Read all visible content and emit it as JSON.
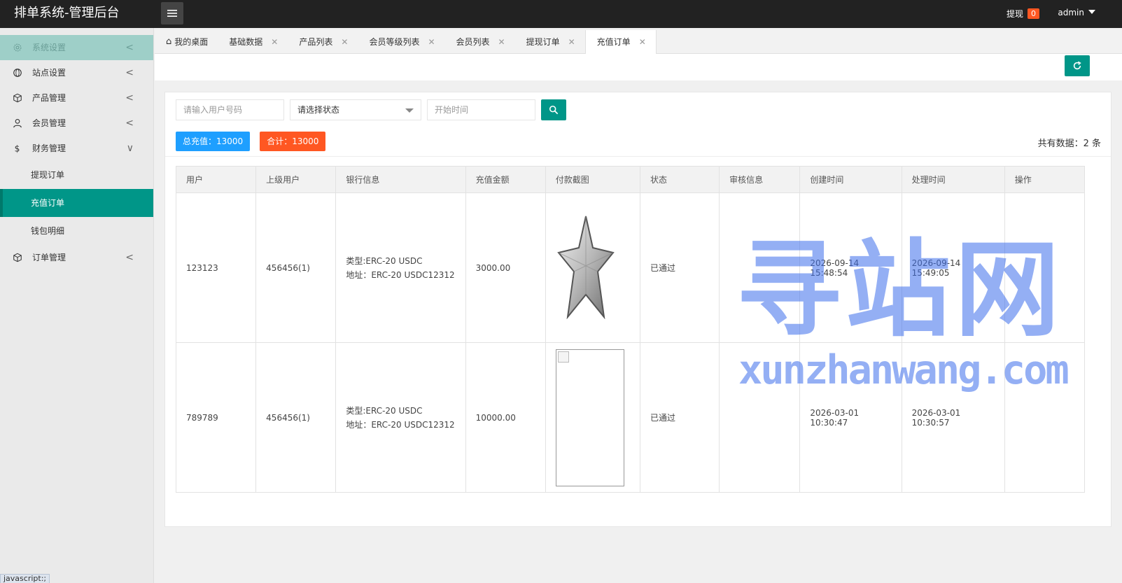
{
  "header": {
    "title": "排单系统-管理后台",
    "withdraw_label": "提现",
    "withdraw_count": "0",
    "user": "admin"
  },
  "sidebar": {
    "items": [
      {
        "label": "系统设置",
        "icon": "gear-icon"
      },
      {
        "label": "站点设置",
        "icon": "globe-icon"
      },
      {
        "label": "产品管理",
        "icon": "cube-icon"
      },
      {
        "label": "会员管理",
        "icon": "user-icon"
      },
      {
        "label": "财务管理",
        "icon": "dollar-icon"
      }
    ],
    "sub_items": [
      "提现订单",
      "充值订单",
      "钱包明细"
    ],
    "order_mgmt": {
      "label": "订单管理",
      "icon": "cube-icon"
    }
  },
  "tabs": [
    {
      "label": "我的桌面"
    },
    {
      "label": "基础数据"
    },
    {
      "label": "产品列表"
    },
    {
      "label": "会员等级列表"
    },
    {
      "label": "会员列表"
    },
    {
      "label": "提现订单"
    },
    {
      "label": "充值订单"
    }
  ],
  "search": {
    "user_placeholder": "请输入用户号码",
    "status_select": "请选择状态",
    "start_time_placeholder": "开始时间"
  },
  "summary": {
    "total_recharge": "总充值：13000",
    "sum": "合计：13000",
    "total_count": "共有数据：2 条"
  },
  "table": {
    "headers": [
      "用户",
      "上级用户",
      "银行信息",
      "充值金额",
      "付款截图",
      "状态",
      "审核信息",
      "创建时间",
      "处理时间",
      "操作"
    ],
    "rows": [
      {
        "user": "123123",
        "parent": "456456(1)",
        "bank_type": "类型:ERC-20 USDC",
        "bank_addr": "地址：ERC-20 USDC12312",
        "amount": "3000.00",
        "status": "已通过",
        "review": "",
        "created": "2026-09-14 15:48:54",
        "processed": "2026-09-14 15:49:05"
      },
      {
        "user": "789789",
        "parent": "456456(1)",
        "bank_type": "类型:ERC-20 USDC",
        "bank_addr": "地址：ERC-20 USDC12312",
        "amount": "10000.00",
        "status": "已通过",
        "review": "",
        "created": "2026-03-01 10:30:47",
        "processed": "2026-03-01 10:30:57"
      }
    ]
  },
  "watermark": {
    "cn": "寻站网",
    "en": "xunzhanwang.com"
  },
  "statusbar": "javascript:;",
  "colors": {
    "primary": "#009688",
    "blue": "#1e9fff",
    "orange": "#ff5722",
    "header": "#222222"
  }
}
